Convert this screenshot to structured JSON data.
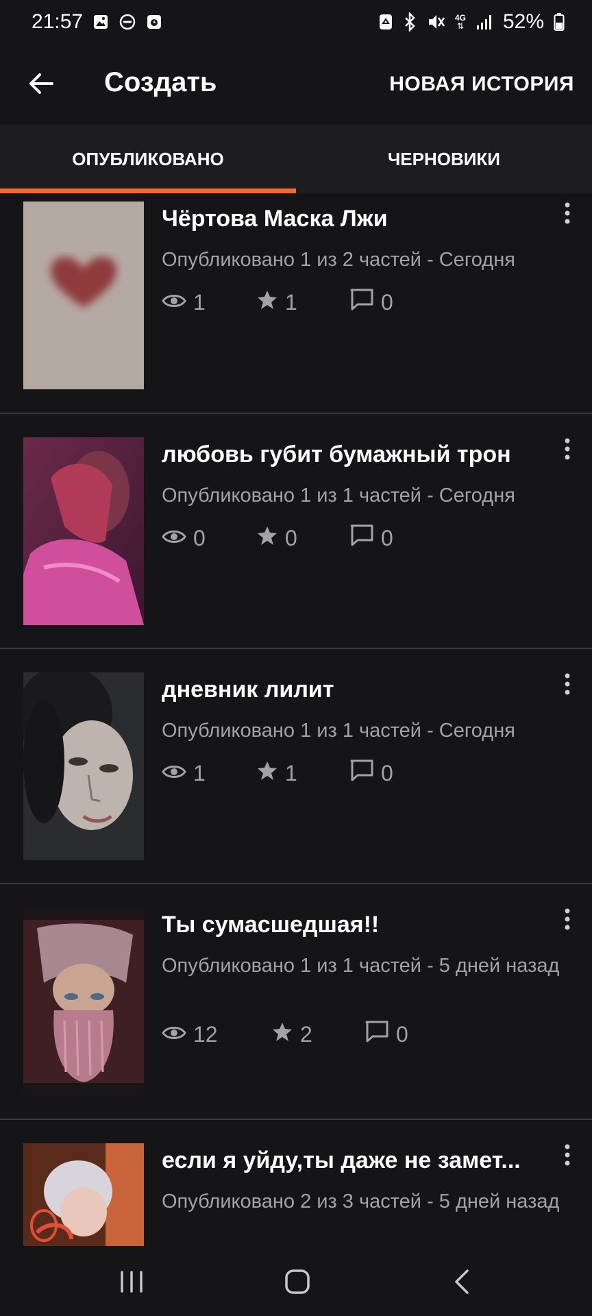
{
  "status_bar": {
    "time": "21:57",
    "battery": "52%",
    "network": "4G",
    "left_icons": [
      "image-icon",
      "dnd-icon",
      "clock-app-icon"
    ],
    "right_icons": [
      "recycle-icon",
      "bluetooth-icon",
      "mute-icon",
      "4g-icon",
      "signal-icon",
      "battery-icon"
    ]
  },
  "app_bar": {
    "title": "Создать",
    "action": "НОВАЯ ИСТОРИЯ"
  },
  "tabs": [
    {
      "label": "ОПУБЛИКОВАНО",
      "active": true
    },
    {
      "label": "ЧЕРНОВИКИ",
      "active": false
    }
  ],
  "accent_color": "#f26b2f",
  "stories": [
    {
      "title": "Чёртова Маска Лжи",
      "meta": "Опубликовано 1 из 2 частей - Сегодня",
      "views": "1",
      "votes": "1",
      "comments": "0"
    },
    {
      "title": "любовь губит бумажный трон",
      "meta": "Опубликовано 1 из 1 частей - Сегодня",
      "views": "0",
      "votes": "0",
      "comments": "0"
    },
    {
      "title": "дневник лилит",
      "meta": "Опубликовано 1 из 1 частей - Сегодня",
      "views": "1",
      "votes": "1",
      "comments": "0"
    },
    {
      "title": "Ты сумасшедшая!!",
      "meta": "Опубликовано 1 из 1 частей - 5 дней назад",
      "views": "12",
      "votes": "2",
      "comments": "0"
    },
    {
      "title": "если я уйду,ты даже не замет...",
      "meta": "Опубликовано 2 из 3 частей - 5 дней назад",
      "views": "",
      "votes": "",
      "comments": ""
    }
  ],
  "nav_bar": [
    "recents-button",
    "home-button",
    "back-button"
  ]
}
